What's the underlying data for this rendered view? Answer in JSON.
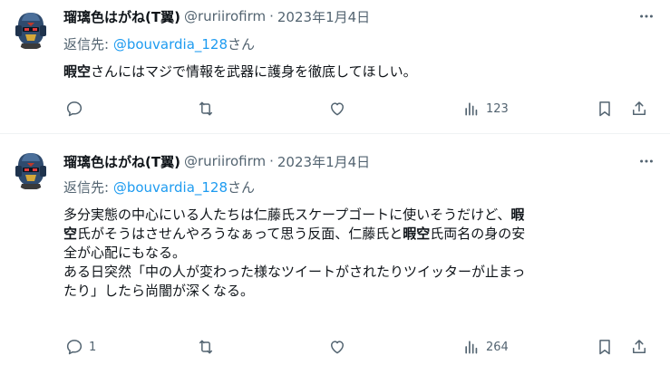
{
  "tweets": [
    {
      "display_name": "瑠璃色はがね(T翼)",
      "handle": "@ruriirofirm",
      "separator": "·",
      "date": "2023年1月4日",
      "reply_prefix": "返信先: ",
      "reply_mention": "@bouvardia_128",
      "reply_suffix": "さん",
      "lines": [
        [
          {
            "text": "暇空",
            "bold": true
          },
          {
            "text": "さんにはマジで情報を武器に護身を徹底してほしい。",
            "bold": false
          }
        ]
      ],
      "reply_count": "",
      "views": "123"
    },
    {
      "display_name": "瑠璃色はがね(T翼)",
      "handle": "@ruriirofirm",
      "separator": "·",
      "date": "2023年1月4日",
      "reply_prefix": "返信先: ",
      "reply_mention": "@bouvardia_128",
      "reply_suffix": "さん",
      "lines": [
        [
          {
            "text": "多分実態の中心にいる人たちは仁藤氏スケープゴートに使いそうだけど、",
            "bold": false
          },
          {
            "text": "暇",
            "bold": true
          }
        ],
        [
          {
            "text": "空",
            "bold": true
          },
          {
            "text": "氏がそうはさせんやろうなぁって思う反面、仁藤氏と",
            "bold": false
          },
          {
            "text": "暇空",
            "bold": true
          },
          {
            "text": "氏両名の身の安",
            "bold": false
          }
        ],
        [
          {
            "text": "全が心配にもなる。",
            "bold": false
          }
        ],
        [
          {
            "text": "ある日突然「中の人が変わった様なツイートがされたりツイッターが止まっ",
            "bold": false
          }
        ],
        [
          {
            "text": "たり」したら尚闇が深くなる。",
            "bold": false
          }
        ]
      ],
      "reply_count": "1",
      "views": "264"
    }
  ]
}
